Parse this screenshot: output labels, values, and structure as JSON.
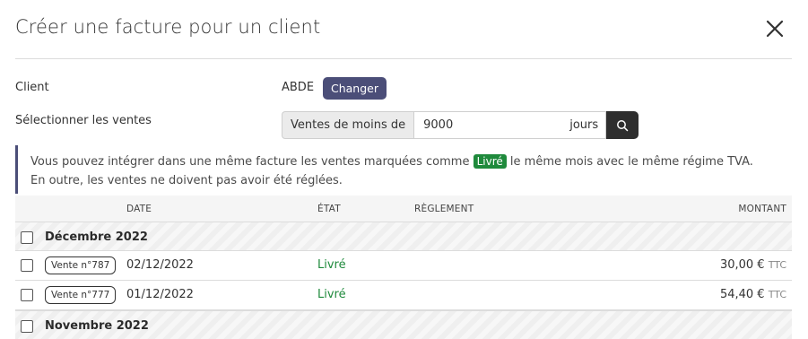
{
  "modal": {
    "title": "Créer une facture pour un client",
    "close_icon": "close-icon"
  },
  "form": {
    "client_label": "Client",
    "client_value": "ABDE",
    "change_button": "Changer",
    "sales_label": "Sélectionner les ventes",
    "sales_prefix": "Ventes de moins de",
    "sales_days_value": "9000",
    "sales_suffix": "jours",
    "search_icon": "search-icon"
  },
  "info": {
    "line1_before": "Vous pouvez intégrer dans une même facture les ventes marquées comme ",
    "badge": "Livré",
    "line1_after": " le même mois avec le même régime TVA.",
    "line2": "En outre, les ventes ne doivent pas avoir été réglées."
  },
  "table": {
    "headers": {
      "date": "DATE",
      "etat": "ÉTAT",
      "reglement": "RÈGLEMENT",
      "montant": "MONTANT"
    },
    "groups": [
      {
        "label": "Décembre 2022",
        "rows": [
          {
            "ref": "Vente n°787",
            "date": "02/12/2022",
            "etat": "Livré",
            "reglement": "",
            "montant": "30,00 €",
            "suffix": "TTC"
          },
          {
            "ref": "Vente n°777",
            "date": "01/12/2022",
            "etat": "Livré",
            "reglement": "",
            "montant": "54,40 €",
            "suffix": "TTC"
          }
        ]
      },
      {
        "label": "Novembre 2022",
        "rows": []
      }
    ]
  },
  "colors": {
    "accent": "#4b4e78",
    "success": "#1f8a3c"
  }
}
